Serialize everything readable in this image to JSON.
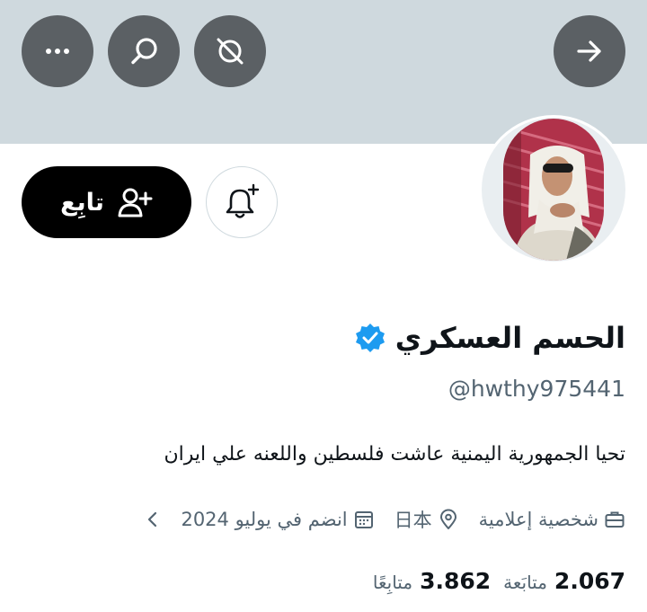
{
  "header": {
    "more_icon": "more-horizontal-icon",
    "search_icon": "search-icon",
    "mute_icon": "mute-icon",
    "forward_icon": "arrow-right-icon",
    "banner_color": "#cfd9de"
  },
  "profile": {
    "display_name": "الحسم العسكري",
    "verified": true,
    "verified_color": "#1d9bf0",
    "handle": "@hwthy975441",
    "bio": "تحيا الجمهورية اليمنية عاشت فلسطين واللعنه علي ايران",
    "category": "شخصية إعلامية",
    "location": "日本",
    "joined": "انضم في يوليو 2024"
  },
  "actions": {
    "follow_label": "تابِع",
    "follow_icon": "add-user-icon",
    "bell_icon": "notification-bell-plus-icon"
  },
  "stats": {
    "following_count": "2.067",
    "following_label": "متابَعة",
    "followers_count": "3.862",
    "followers_label": "متابِعًا"
  }
}
